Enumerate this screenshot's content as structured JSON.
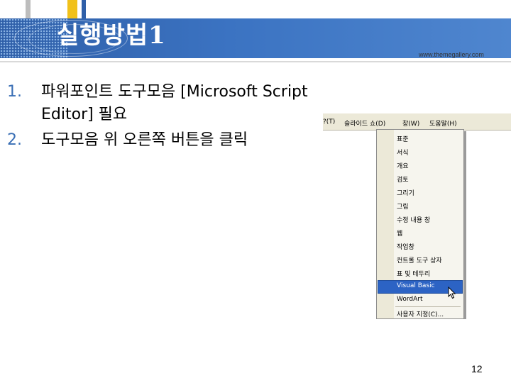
{
  "header": {
    "title": "실행방법1",
    "site_url": "www.themegallery.com",
    "colors": {
      "band": "#3b73c2",
      "accent_yellow": "#f1c11a",
      "accent_grey": "#9a9a9a",
      "accent_blue": "#2f5fa8"
    }
  },
  "body": {
    "items": [
      {
        "number": "1.",
        "text": "파워포인트 도구모음 [Microsoft Script Editor] 필요"
      },
      {
        "number": "2.",
        "text": "도구모음 위 오른쪽 버튼을 클릭"
      }
    ]
  },
  "screenshot": {
    "menubar": [
      "?(T)",
      "슬라이드 쇼(D)",
      "창(W)",
      "도움말(H)"
    ],
    "dropdown_items": [
      "표준",
      "서식",
      "개요",
      "검토",
      "그리기",
      "그림",
      "수정 내용 창",
      "웹",
      "작업창",
      "컨트롤 도구 상자",
      "표 및 테두리",
      "Visual Basic",
      "WordArt",
      "사용자 지정(C)..."
    ],
    "selected_item": "Visual Basic"
  },
  "footer": {
    "page_number": "12"
  }
}
